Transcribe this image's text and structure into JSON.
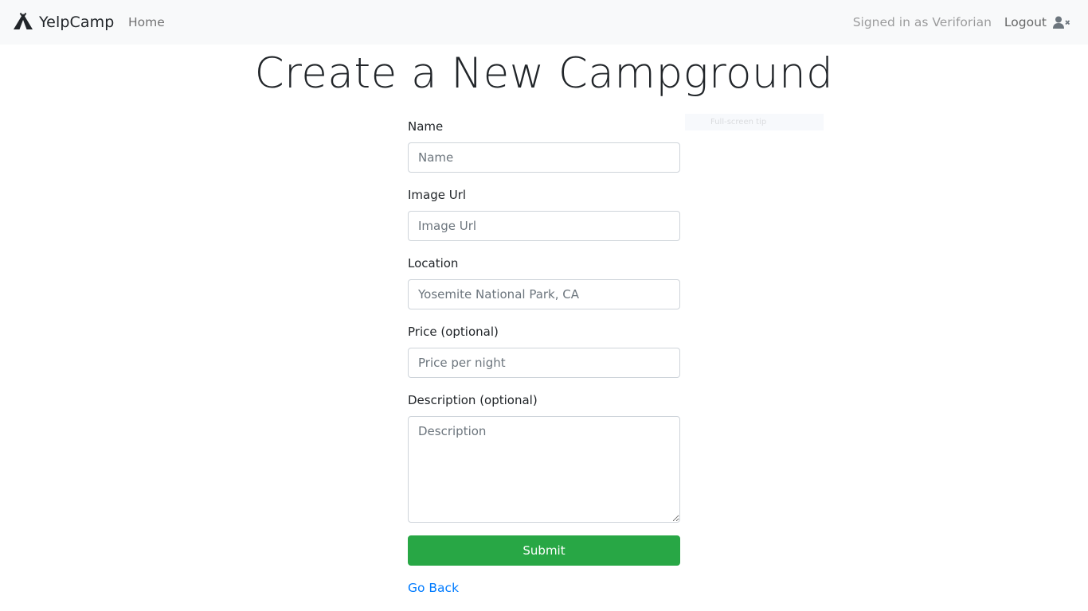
{
  "navbar": {
    "brand": "YelpCamp",
    "brand_icon": "tent-icon",
    "home": "Home",
    "signed_in": "Signed in as Veriforian",
    "logout": "Logout",
    "logout_icon": "user-times-icon"
  },
  "page": {
    "title": "Create a New Campground"
  },
  "form": {
    "name": {
      "label": "Name",
      "placeholder": "Name",
      "value": ""
    },
    "image_url": {
      "label": "Image Url",
      "placeholder": "Image Url",
      "value": ""
    },
    "location": {
      "label": "Location",
      "placeholder": "Yosemite National Park, CA",
      "value": ""
    },
    "price": {
      "label": "Price (optional)",
      "placeholder": "Price per night",
      "value": ""
    },
    "description": {
      "label": "Description (optional)",
      "placeholder": "Description",
      "value": ""
    },
    "submit": "Submit",
    "go_back": "Go Back"
  },
  "overlay": {
    "tip": "Full-screen tip"
  },
  "colors": {
    "navbar_bg": "#f8f9fa",
    "submit_bg": "#28a745",
    "link": "#007bff"
  }
}
